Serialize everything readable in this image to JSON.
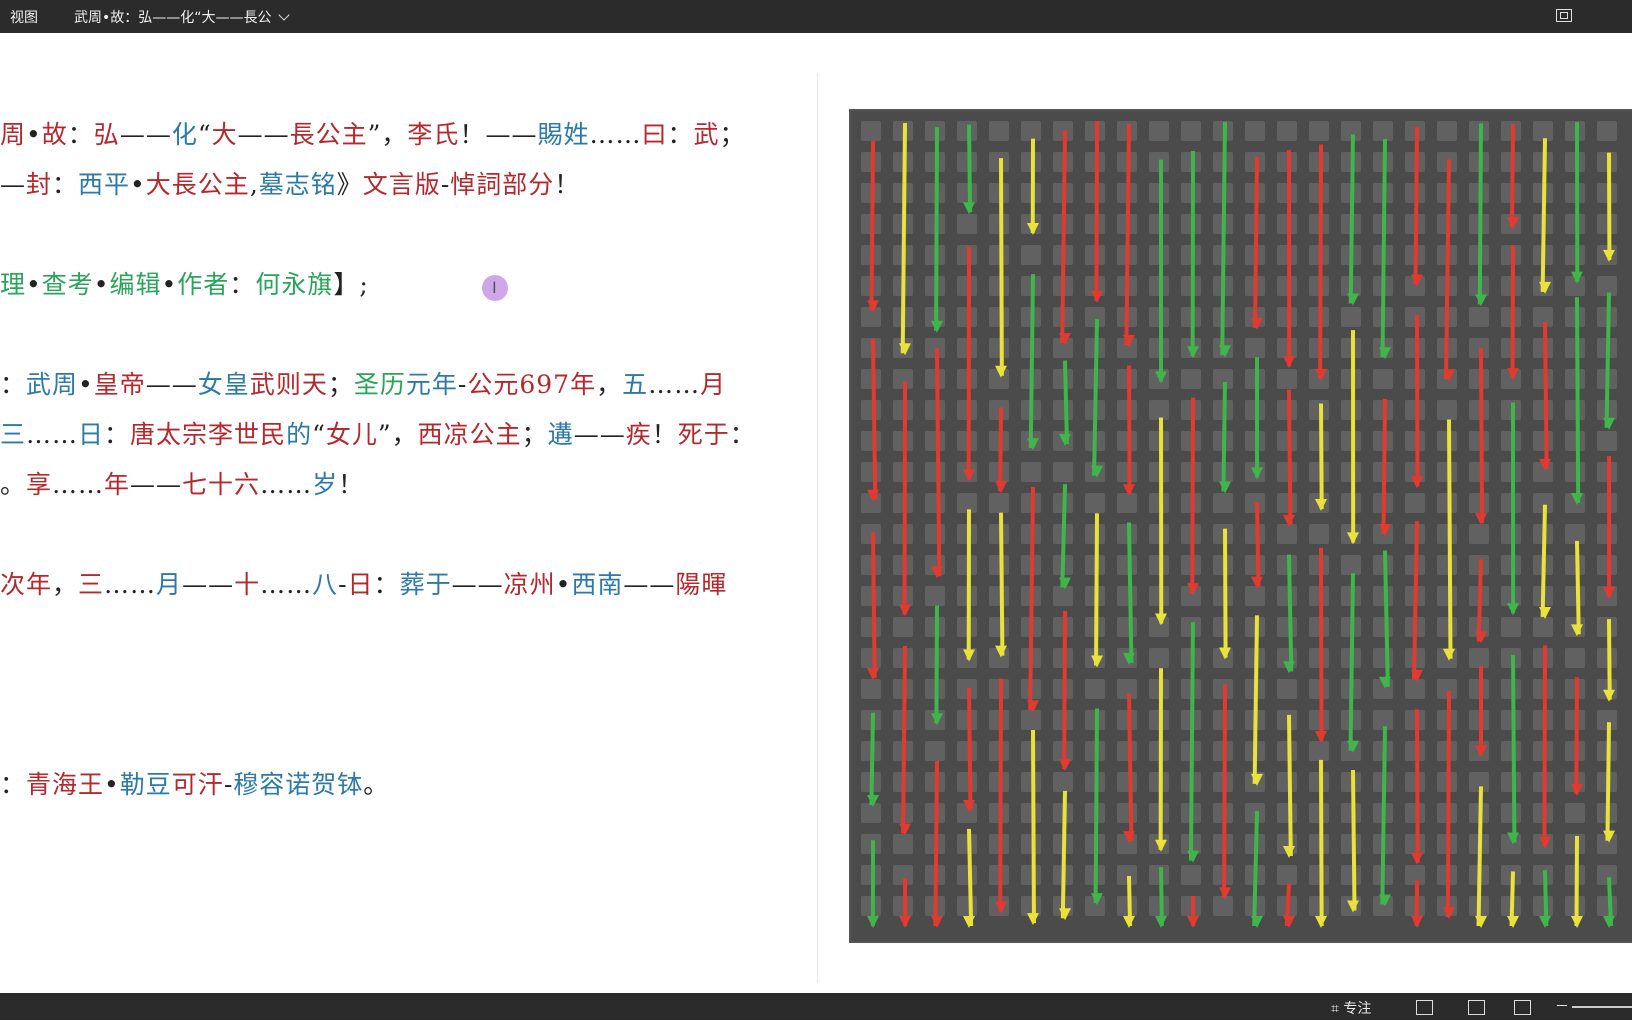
{
  "titlebar": {
    "view_label": "视图",
    "doc_title": "武周•故：弘——化“大——長公"
  },
  "document": {
    "lines": [
      [
        [
          "r",
          "周"
        ],
        [
          "k",
          "•"
        ],
        [
          "r",
          "故"
        ],
        [
          "k",
          "："
        ],
        [
          "r",
          "弘"
        ],
        [
          "k",
          "——"
        ],
        [
          "b",
          "化"
        ],
        [
          "k",
          "“"
        ],
        [
          "r",
          "大"
        ],
        [
          "k",
          "——"
        ],
        [
          "r",
          "長公主"
        ],
        [
          "k",
          "”，"
        ],
        [
          "r",
          "李氏"
        ],
        [
          "k",
          "！——"
        ],
        [
          "b",
          "賜姓"
        ],
        [
          "k",
          "……"
        ],
        [
          "r",
          "曰"
        ],
        [
          "k",
          "："
        ],
        [
          "r",
          "武"
        ],
        [
          "k",
          "；"
        ]
      ],
      [
        [
          "k",
          "—"
        ],
        [
          "r",
          "封"
        ],
        [
          "k",
          "："
        ],
        [
          "b",
          "西平"
        ],
        [
          "k",
          "•"
        ],
        [
          "r",
          "大長公主"
        ],
        [
          "k",
          ","
        ],
        [
          "b",
          "墓志铭"
        ],
        [
          "k",
          "》"
        ],
        [
          "r",
          "文言版"
        ],
        [
          "k",
          "-"
        ],
        [
          "r",
          "悼詞部分"
        ],
        [
          "k",
          "！"
        ]
      ],
      [
        [
          "g",
          "理"
        ],
        [
          "k",
          "•"
        ],
        [
          "g",
          "查考"
        ],
        [
          "k",
          "•"
        ],
        [
          "g",
          "编辑"
        ],
        [
          "k",
          "•"
        ],
        [
          "g",
          "作者"
        ],
        [
          "k",
          "："
        ],
        [
          "g",
          "何永旗"
        ],
        [
          "k",
          "】;"
        ]
      ],
      [
        [
          "k",
          "："
        ],
        [
          "b",
          "武周"
        ],
        [
          "k",
          "•"
        ],
        [
          "r",
          "皇帝"
        ],
        [
          "k",
          "——"
        ],
        [
          "b",
          "女皇"
        ],
        [
          "r",
          "武则天"
        ],
        [
          "k",
          "；"
        ],
        [
          "g",
          "圣历"
        ],
        [
          "b",
          "元年"
        ],
        [
          "k",
          "-"
        ],
        [
          "r",
          "公元"
        ],
        [
          "r",
          "697"
        ],
        [
          "r",
          "年"
        ],
        [
          "k",
          "，"
        ],
        [
          "b",
          "五"
        ],
        [
          "k",
          "……"
        ],
        [
          "r",
          "月"
        ]
      ],
      [
        [
          "b",
          "三"
        ],
        [
          "k",
          "……"
        ],
        [
          "b",
          "日"
        ],
        [
          "k",
          "："
        ],
        [
          "r",
          "唐太宗李世民"
        ],
        [
          "b",
          "的"
        ],
        [
          "k",
          "“"
        ],
        [
          "r",
          "女儿"
        ],
        [
          "k",
          "”，"
        ],
        [
          "r",
          "西凉公主"
        ],
        [
          "k",
          "；"
        ],
        [
          "b",
          "遘"
        ],
        [
          "k",
          "——"
        ],
        [
          "r",
          "疾"
        ],
        [
          "k",
          "！"
        ],
        [
          "r",
          "死于"
        ],
        [
          "k",
          "："
        ]
      ],
      [
        [
          "k",
          "。"
        ],
        [
          "r",
          "享"
        ],
        [
          "k",
          "……"
        ],
        [
          "r",
          "年"
        ],
        [
          "k",
          "——"
        ],
        [
          "r",
          "七十六"
        ],
        [
          "k",
          "……"
        ],
        [
          "b",
          "岁"
        ],
        [
          "k",
          "！"
        ]
      ],
      [
        [
          "r",
          "次年"
        ],
        [
          "k",
          "，"
        ],
        [
          "r",
          "三"
        ],
        [
          "k",
          "……"
        ],
        [
          "b",
          "月"
        ],
        [
          "k",
          "——"
        ],
        [
          "r",
          "十"
        ],
        [
          "k",
          "……"
        ],
        [
          "b",
          "八"
        ],
        [
          "k",
          "-"
        ],
        [
          "r",
          "日"
        ],
        [
          "k",
          "："
        ],
        [
          "b",
          "葬于"
        ],
        [
          "k",
          "——"
        ],
        [
          "r",
          "凉州"
        ],
        [
          "k",
          "•"
        ],
        [
          "b",
          "西南"
        ],
        [
          "k",
          "——"
        ],
        [
          "r",
          "陽暉"
        ]
      ],
      [
        [
          "k",
          "："
        ],
        [
          "r",
          "青海王"
        ],
        [
          "k",
          "•"
        ],
        [
          "b",
          "勒豆"
        ],
        [
          "r",
          "可汗"
        ],
        [
          "k",
          "-"
        ],
        [
          "b",
          "穆容诺贺钵"
        ],
        [
          "k",
          "。"
        ]
      ]
    ]
  },
  "image": {
    "description_icon": "stele-rubbing-image"
  },
  "statusbar": {
    "focus_label": "专注",
    "zoom_minus": "－"
  },
  "colors": {
    "red": "#b5282d",
    "blue": "#2c7aa9",
    "green": "#2ba35b",
    "black": "#222222",
    "dark_bar": "#2b2b2b"
  }
}
